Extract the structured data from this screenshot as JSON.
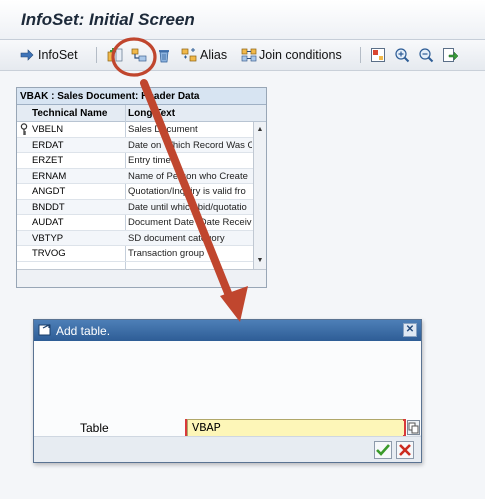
{
  "window": {
    "title": "InfoSet: Initial Screen"
  },
  "toolbar": {
    "infoset_label": "InfoSet",
    "alias_label": "Alias",
    "join_label": "Join conditions"
  },
  "field_list": {
    "header": "VBAK : Sales Document: Header Data",
    "columns": [
      "Technical Name",
      "Long Text"
    ],
    "rows": [
      {
        "name": "VBELN",
        "text": "Sales Document"
      },
      {
        "name": "ERDAT",
        "text": "Date on Which Record Was C"
      },
      {
        "name": "ERZET",
        "text": "Entry time"
      },
      {
        "name": "ERNAM",
        "text": "Name of Person who Create"
      },
      {
        "name": "ANGDT",
        "text": "Quotation/Inquiry is valid fro"
      },
      {
        "name": "BNDDT",
        "text": "Date until which bid/quotatio"
      },
      {
        "name": "AUDAT",
        "text": "Document Date (Date Receiv"
      },
      {
        "name": "VBTYP",
        "text": "SD document category"
      },
      {
        "name": "TRVOG",
        "text": "Transaction group"
      }
    ]
  },
  "dialog": {
    "title": "Add table.",
    "field_label": "Table",
    "field_value": "VBAP"
  },
  "colors": {
    "annotation": "#c0462e",
    "dialog_title": "#2e5d96",
    "input_bg": "#fdf6b8"
  }
}
